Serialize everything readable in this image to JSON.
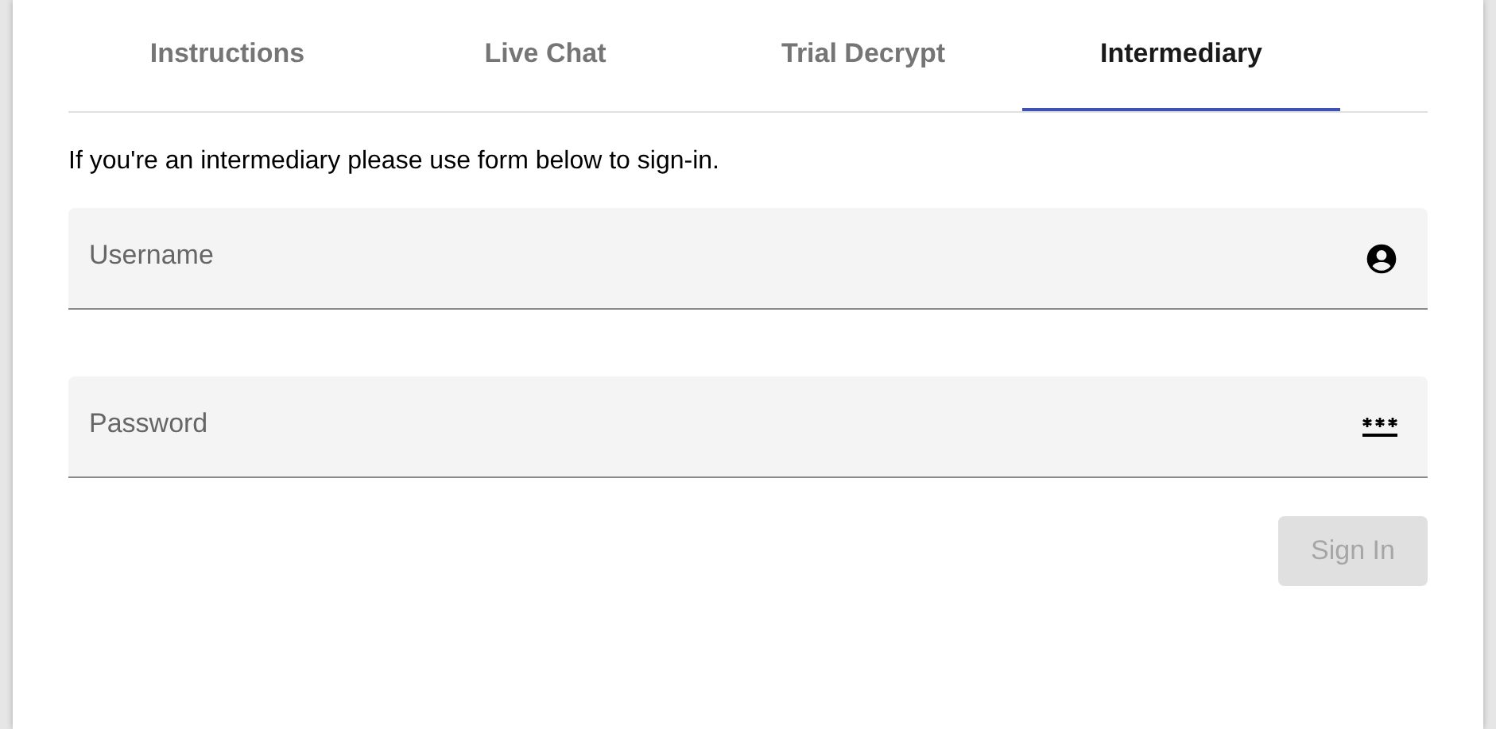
{
  "tabs": [
    {
      "label": "Instructions",
      "selected": false
    },
    {
      "label": "Live Chat",
      "selected": false
    },
    {
      "label": "Trial Decrypt",
      "selected": false
    },
    {
      "label": "Intermediary",
      "selected": true
    }
  ],
  "intro": "If you're an intermediary please use form below to sign-in.",
  "fields": [
    {
      "kind": "username",
      "placeholder": "Username"
    },
    {
      "kind": "password",
      "placeholder": "Password"
    }
  ],
  "sign_in_button": {
    "label": "Sign In",
    "disabled": true
  }
}
